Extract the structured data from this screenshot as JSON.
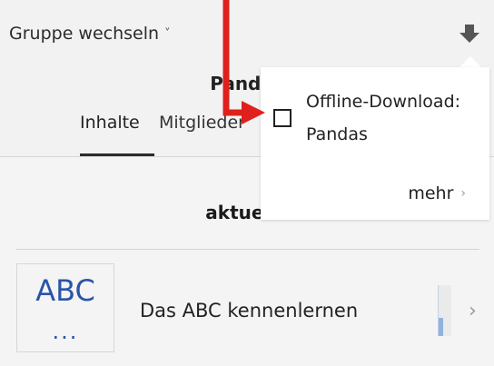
{
  "header": {
    "group_switch_label": "Gruppe wechseln",
    "group_switch_chevron": "˅",
    "title": "Pandas",
    "download_icon": "download-arrow-icon"
  },
  "tabs": [
    {
      "label": "Inhalte",
      "active": true
    },
    {
      "label": "Mitglieder",
      "active": false
    }
  ],
  "section": {
    "heading": "aktuelle"
  },
  "list": {
    "items": [
      {
        "thumbnail_text": "ABC",
        "thumbnail_more": "...",
        "title": "Das ABC kennenlernen",
        "progress": 0.35,
        "chevron": "›"
      }
    ]
  },
  "popup": {
    "checkbox_checked": false,
    "label_line1": "Offline-Download:",
    "label_line2": "Pandas",
    "more_label": "mehr",
    "more_chevron": "›"
  },
  "colors": {
    "background": "#f2f2f2",
    "popup_bg": "#ffffff",
    "accent_blue": "#2a55a6",
    "annotation_red": "#e0201c"
  }
}
